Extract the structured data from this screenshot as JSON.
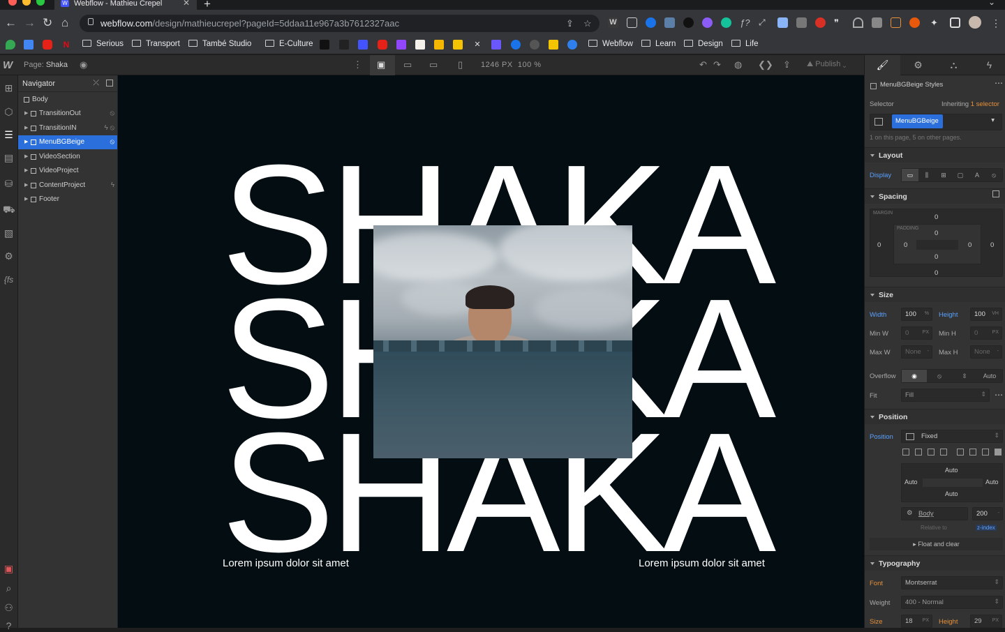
{
  "browser": {
    "tab_title": "Webflow - Mathieu Crepel",
    "tab_favicon": "W",
    "url_host": "webflow.com",
    "url_path": "/design/mathieucrepel?pageId=5ddaa11e967a3b7612327aac"
  },
  "bookmarks": [
    "Serious",
    "Transport",
    "També Studio",
    "E-Culture",
    "Webflow",
    "Learn",
    "Design",
    "Life"
  ],
  "designer": {
    "page_prefix": "Page:",
    "page_name": "Shaka",
    "canvas_width": "1246 PX",
    "zoom": "100 %",
    "publish_label": "Publish"
  },
  "navigator": {
    "title": "Navigator",
    "root": "Body",
    "items": [
      {
        "label": "TransitionOut"
      },
      {
        "label": "TransitionIN"
      },
      {
        "label": "MenuBGBeige"
      },
      {
        "label": "VideoSection"
      },
      {
        "label": "VideoProject"
      },
      {
        "label": "ContentProject"
      },
      {
        "label": "Footer"
      }
    ]
  },
  "canvas": {
    "headline": "SHAKA",
    "caption_left": "Lorem ipsum dolor sit amet",
    "caption_right": "Lorem ipsum dolor sit amet"
  },
  "style_panel": {
    "styles_title": "MenuBGBeige Styles",
    "selector_label": "Selector",
    "inheriting_text": "Inheriting",
    "inheriting_count": "1 selector",
    "selector_chip": "MenuBGBeige",
    "selector_usage": "1 on this page, 5 on other pages.",
    "layout": {
      "title": "Layout",
      "display_label": "Display"
    },
    "spacing": {
      "title": "Spacing",
      "margin_label": "MARGIN",
      "padding_label": "PADDING",
      "m_top": "0",
      "m_right": "0",
      "m_bottom": "0",
      "m_left": "0",
      "p_top": "0",
      "p_right": "0",
      "p_bottom": "0",
      "p_left": "0"
    },
    "size": {
      "title": "Size",
      "width_label": "Width",
      "width": "100",
      "width_unit": "%",
      "height_label": "Height",
      "height": "100",
      "height_unit": "VH",
      "minw_label": "Min W",
      "minw": "0",
      "minw_unit": "PX",
      "minh_label": "Min H",
      "minh": "0",
      "minh_unit": "PX",
      "maxw_label": "Max W",
      "maxw": "None",
      "maxh_label": "Max H",
      "maxh": "None",
      "overflow_label": "Overflow",
      "overflow_auto": "Auto",
      "fit_label": "Fit",
      "fit": "Fill"
    },
    "position": {
      "title": "Position",
      "position_label": "Position",
      "position": "Fixed",
      "top": "Auto",
      "left": "Auto",
      "right": "Auto",
      "bottom": "Auto",
      "relative_el": "Body",
      "zindex": "200",
      "relative_label": "Relative to",
      "zindex_label": "z-index",
      "float_label": "Float and clear"
    },
    "typography": {
      "title": "Typography",
      "font_label": "Font",
      "font": "Montserrat",
      "weight_label": "Weight",
      "weight": "400 - Normal",
      "size_label": "Size",
      "size": "18",
      "size_unit": "PX",
      "lheight_label": "Height",
      "lheight": "29",
      "lheight_unit": "PX"
    }
  }
}
